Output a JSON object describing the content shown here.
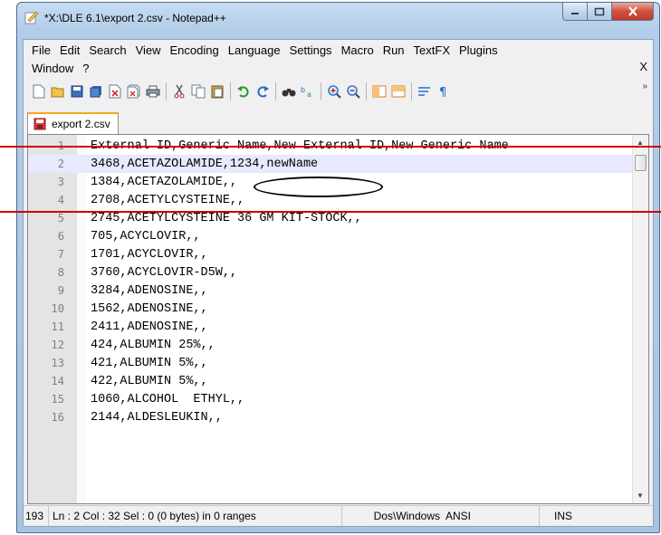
{
  "window": {
    "title": "*X:\\DLE 6.1\\export 2.csv - Notepad++",
    "accent_color": "#c7dcf1"
  },
  "menu": {
    "row1": [
      "File",
      "Edit",
      "Search",
      "View",
      "Encoding",
      "Language",
      "Settings",
      "Macro",
      "Run",
      "TextFX",
      "Plugins"
    ],
    "row2": [
      "Window",
      "?"
    ],
    "close_label": "X"
  },
  "toolbar": {
    "icons": [
      "new-file-icon",
      "open-file-icon",
      "save-icon",
      "save-all-icon",
      "close-icon",
      "close-all-icon",
      "print-icon",
      "cut-icon",
      "copy-icon",
      "paste-icon",
      "undo-icon",
      "redo-icon",
      "find-icon",
      "replace-icon",
      "zoom-in-icon",
      "zoom-out-icon",
      "sync-v-icon",
      "sync-h-icon",
      "word-wrap-icon",
      "show-all-chars-icon"
    ],
    "overflow_label": "»"
  },
  "tab": {
    "label": "export 2.csv",
    "icon": "unsaved-file-icon"
  },
  "editor": {
    "lines": [
      {
        "num": "1",
        "text": "External ID,Generic Name,New External ID,New Generic Name"
      },
      {
        "num": "2",
        "text": "3468,ACETAZOLAMIDE,1234,newName"
      },
      {
        "num": "3",
        "text": "1384,ACETAZOLAMIDE,,"
      },
      {
        "num": "4",
        "text": "2708,ACETYLCYSTEINE,,"
      },
      {
        "num": "5",
        "text": "2745,ACETYLCYSTEINE 36 GM KIT-STOCK,,"
      },
      {
        "num": "6",
        "text": "705,ACYCLOVIR,,"
      },
      {
        "num": "7",
        "text": "1701,ACYCLOVIR,,"
      },
      {
        "num": "8",
        "text": "3760,ACYCLOVIR-D5W,,"
      },
      {
        "num": "9",
        "text": "3284,ADENOSINE,,"
      },
      {
        "num": "10",
        "text": "1562,ADENOSINE,,"
      },
      {
        "num": "11",
        "text": "2411,ADENOSINE,,"
      },
      {
        "num": "12",
        "text": "424,ALBUMIN 25%,,"
      },
      {
        "num": "13",
        "text": "421,ALBUMIN 5%,,"
      },
      {
        "num": "14",
        "text": "422,ALBUMIN 5%,,"
      },
      {
        "num": "15",
        "text": "1060,ALCOHOL  ETHYL,,"
      },
      {
        "num": "16",
        "text": "2144,ALDESLEUKIN,,"
      }
    ],
    "current_line": 2
  },
  "status": {
    "length": "193",
    "position": "Ln : 2   Col : 32   Sel : 0 (0 bytes) in 0 ranges",
    "eol": "Dos\\Windows",
    "encoding": "ANSI",
    "mode": "INS"
  },
  "annotation": {
    "highlight_color": "#d00000"
  }
}
